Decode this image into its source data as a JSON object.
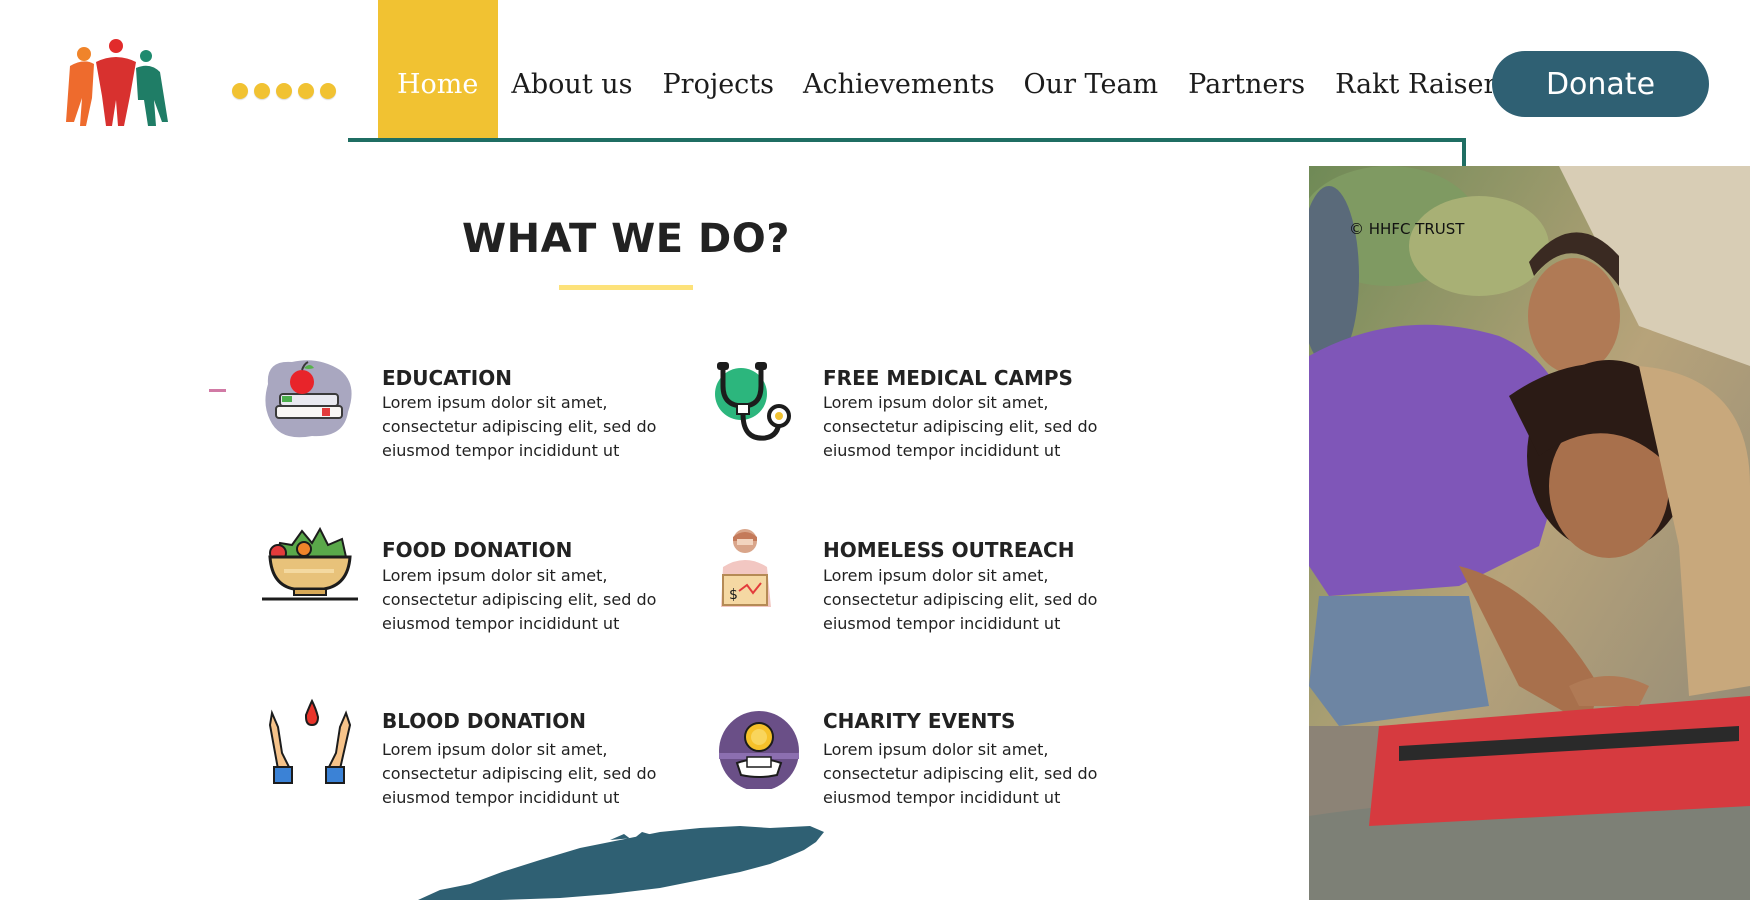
{
  "header": {
    "logo_icon": "family-people-logo",
    "dots_count": 5,
    "nav": [
      {
        "label": "Home",
        "active": true
      },
      {
        "label": "About us",
        "active": false
      },
      {
        "label": "Projects",
        "active": false
      },
      {
        "label": "Achievements",
        "active": false
      },
      {
        "label": "Our Team",
        "active": false
      },
      {
        "label": "Partners",
        "active": false
      },
      {
        "label": "Rakt Raiser",
        "active": false
      }
    ],
    "donate_label": "Donate"
  },
  "section": {
    "title": "WHAT WE DO?"
  },
  "services": [
    {
      "title": "EDUCATION",
      "icon": "books-apple-icon",
      "desc": "Lorem ipsum dolor sit amet, consectetur adipiscing elit, sed do eiusmod tempor incididunt ut"
    },
    {
      "title": "FREE MEDICAL CAMPS",
      "icon": "stethoscope-icon",
      "desc": "Lorem ipsum dolor sit amet, consectetur adipiscing elit, sed do eiusmod tempor incididunt ut"
    },
    {
      "title": "FOOD DONATION",
      "icon": "salad-bowl-icon",
      "desc": "Lorem ipsum dolor sit amet, consectetur adipiscing elit, sed do eiusmod tempor incididunt ut"
    },
    {
      "title": "HOMELESS OUTREACH",
      "icon": "homeless-person-icon",
      "desc": "Lorem ipsum dolor sit amet, consectetur adipiscing elit, sed do eiusmod tempor incididunt ut"
    },
    {
      "title": "BLOOD DONATION",
      "icon": "hands-blood-drop-icon",
      "desc": "Lorem ipsum dolor sit amet, consectetur adipiscing elit, sed do eiusmod tempor incididunt ut"
    },
    {
      "title": "CHARITY EVENTS",
      "icon": "coin-hand-icon",
      "desc": "Lorem ipsum dolor sit amet, consectetur adipiscing elit, sed do eiusmod tempor incididunt ut"
    }
  ],
  "photo": {
    "credit": "© HHFC TRUST"
  },
  "colors": {
    "accent_yellow": "#f1c232",
    "donate_blue": "#2f6073",
    "nav_line_teal": "#1f6e63",
    "underline_yellow": "#fde27a"
  }
}
